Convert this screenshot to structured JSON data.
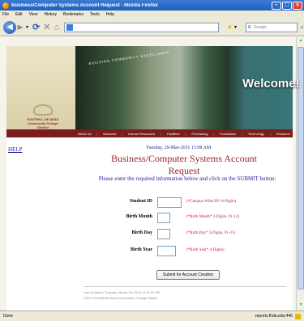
{
  "window": {
    "title": "Business/Computer Systems Account Request - Mozilla Firefox"
  },
  "menu": [
    "File",
    "Edit",
    "View",
    "History",
    "Bookmarks",
    "Tools",
    "Help"
  ],
  "search": {
    "engine": "G",
    "placeholder": "Google"
  },
  "header": {
    "tagline": "BUILDING COMMUNITY EXCELLENCE",
    "welcome": "Welcome!",
    "logo_line1": "FOOTHILL-DE ANZA",
    "logo_line2": "Community College District"
  },
  "nav": [
    "About Us",
    "Business",
    "Human Resources",
    "Facilities",
    "Purchasing",
    "Foundation",
    "Technology",
    "Research"
  ],
  "help_link": "HELP",
  "date": "Tuesday, 29-Mar-2011 11:08 AM",
  "page_title": "Business/Computer Systems Account Request",
  "instructions": "Please enter the required information below and click on the SUBMIT button:",
  "form": {
    "fields": [
      {
        "label": "Student ID",
        "value": "",
        "hint": "(*Campus-Wide ID* 8-Digits)"
      },
      {
        "label": "Birth Month",
        "value": "",
        "hint": "(*Birth Month* 2-Digits, 01-12)"
      },
      {
        "label": "Birth Day",
        "value": "",
        "hint": "(*Birth Day* 2-Digits, 01-31)"
      },
      {
        "label": "Birth Year",
        "value": "",
        "hint": "(*Birth Year* 4-Digits)"
      }
    ],
    "submit_label": "Submit for Account Creation"
  },
  "footer": {
    "updated": "Last Updated: Tuesday, March 1st, 2011 at 15:15 PM",
    "copyright": "©2011 Foothill-De Anza Community College District"
  },
  "status": {
    "left": "Done",
    "right": "reports.fhda.edu:446"
  },
  "colors": {
    "titlebar": "#1f5fbf",
    "nav_bg": "#7c1d1d",
    "title_red": "#a12020",
    "link_blue": "#1a1aa0",
    "hint_red": "#d0142a"
  }
}
